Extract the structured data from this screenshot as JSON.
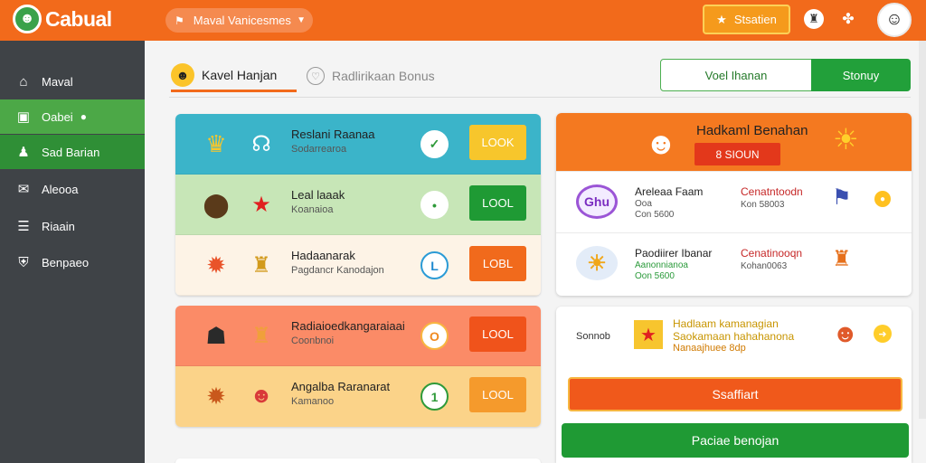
{
  "colors": {
    "brand_orange": "#f26a1b",
    "brand_green": "#22a03a",
    "sidebar_bg": "#3f4347"
  },
  "topbar": {
    "logo": "Cabual",
    "logo_icon": "mascot-head-icon",
    "select_value": "Maval Vanicesmes",
    "button_label": "Stsatien",
    "icons": [
      "trophy-icon",
      "music-note-icon",
      "puzzle-icon"
    ]
  },
  "sidebar": {
    "items": [
      {
        "label": "Maval",
        "icon": "home-icon"
      },
      {
        "label": "Oabei",
        "icon": "gift-icon"
      },
      {
        "label": "Sad Barian",
        "icon": "user-icon"
      },
      {
        "label": "Aleooa",
        "icon": "chat-icon"
      },
      {
        "label": "Riaain",
        "icon": "list-icon"
      },
      {
        "label": "Benpaeo",
        "icon": "shield-icon"
      }
    ]
  },
  "tabs": [
    {
      "label": "Kavel Hanjan",
      "icon": "cup-icon"
    },
    {
      "label": "Radlirikaan Bonus",
      "icon": "heart-icon"
    }
  ],
  "segment": {
    "left": "Voel Ihanan",
    "right": "Stonuy"
  },
  "list_top": [
    {
      "title": "Reslani Raanaa",
      "sub": "Sodarrearoa",
      "status": "✓",
      "button": "LOOK",
      "bg": "#3bb4c9",
      "btn_color": "#f7c62c"
    },
    {
      "title": "Leal laaak",
      "sub": "Koanaioa",
      "status": "•",
      "button": "LOOL",
      "bg": "#c7e6b7",
      "btn_color": "#1f9a34"
    },
    {
      "title": "Hadaanarak",
      "sub": "Pagdancr Kanodajon",
      "status": "L",
      "button": "LOBL",
      "bg": "#fdf3e6",
      "btn_color": "#f16a1c"
    }
  ],
  "list_bottom": [
    {
      "title": "Radiaioedkangaraiaai",
      "sub": "Coonbnoi",
      "status": "O",
      "button": "LOOL",
      "bg": "#fb8b67",
      "btn_color": "#f0531b"
    },
    {
      "title": "Angalba Raranarat",
      "sub": "Kamanoo",
      "status": "1",
      "button": "LOOL",
      "bg": "#fbd389",
      "btn_color": "#f59a2c"
    }
  ],
  "feature_card": {
    "title": "Hadkaml Benahan",
    "badge": "8 SIOUN",
    "entries": [
      {
        "title": "Areleaa Faam",
        "line1": "Ooa",
        "line2": "Con 5600",
        "right_title": "Cenatntoodn",
        "right_sub": "Kon 58003",
        "badge": "Ghu",
        "badge_bg": "#f3ecff",
        "badge_color": "#7a2cc0"
      },
      {
        "title": "Paodiirer Ibanar",
        "line1": "Aanonnianoa",
        "line2": "Oon 5600",
        "right_title": "Cenatinooqn",
        "right_sub": "Kohan0063",
        "badge": "☀",
        "badge_bg": "#e3ecf8",
        "badge_color": "#f0a71a"
      }
    ]
  },
  "promo_card": {
    "label": "Sonnob",
    "line1": "Hadlaam kamanagian",
    "line2": "Saokamaan hahahanona",
    "line3": "Nanaajhuee 8dp",
    "btn_orange": "Ssaffiart",
    "btn_green": "Paciae benojan"
  }
}
